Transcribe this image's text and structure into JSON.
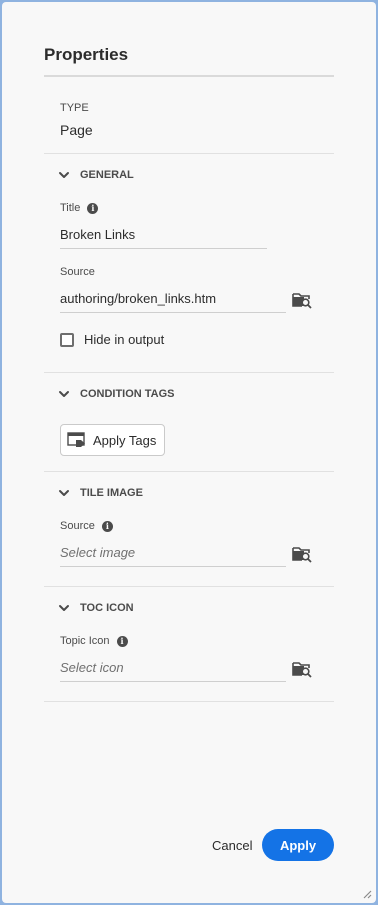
{
  "dialog": {
    "title": "Properties",
    "type_label": "TYPE",
    "type_value": "Page"
  },
  "sections": {
    "general": {
      "label": "GENERAL",
      "title_label": "Title",
      "title_value": "Broken Links",
      "source_label": "Source",
      "source_value": "authoring/broken_links.htm",
      "hide_label": "Hide in output",
      "hide_checked": false
    },
    "condition_tags": {
      "label": "CONDITION TAGS",
      "apply_tags_label": "Apply Tags"
    },
    "tile_image": {
      "label": "TILE IMAGE",
      "source_label": "Source",
      "source_placeholder": "Select image"
    },
    "toc_icon": {
      "label": "TOC ICON",
      "topic_icon_label": "Topic Icon",
      "topic_icon_placeholder": "Select icon"
    }
  },
  "footer": {
    "cancel_label": "Cancel",
    "apply_label": "Apply"
  },
  "colors": {
    "accent": "#1473e6",
    "background": "#f8f8f8",
    "frame": "#8fb3e0"
  },
  "icons": {
    "info": "i"
  }
}
